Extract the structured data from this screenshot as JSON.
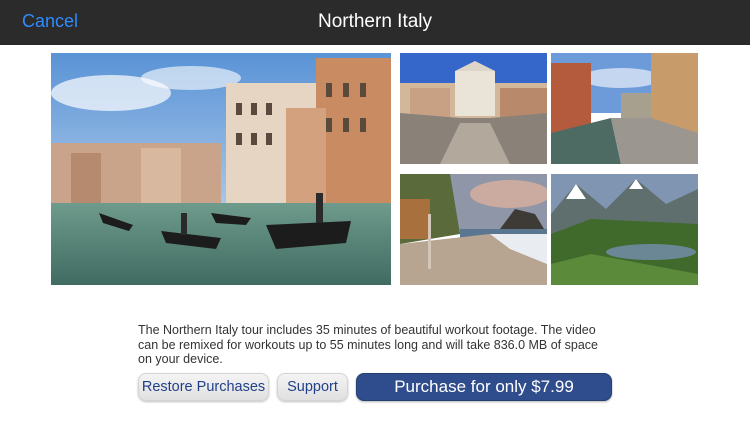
{
  "nav": {
    "cancel_label": "Cancel",
    "title": "Northern Italy"
  },
  "gallery": {
    "images": [
      {
        "name": "venice-gondolas-photo"
      },
      {
        "name": "church-bridge-photo"
      },
      {
        "name": "canal-street-photo"
      },
      {
        "name": "beach-coast-photo"
      },
      {
        "name": "mountain-lake-photo"
      }
    ]
  },
  "description": "The Northern Italy tour includes 35 minutes of beautiful workout footage.  The video can be remixed for workouts up to 55 minutes long and will take 836.0 MB of space on your device.",
  "buttons": {
    "restore_label": "Restore Purchases",
    "support_label": "Support",
    "purchase_label": "Purchase for only $7.99"
  },
  "colors": {
    "nav_background": "#2b2b2b",
    "cancel_link": "#2f8cff",
    "primary_button": "#2f4d8c",
    "secondary_button_text": "#22408a"
  }
}
